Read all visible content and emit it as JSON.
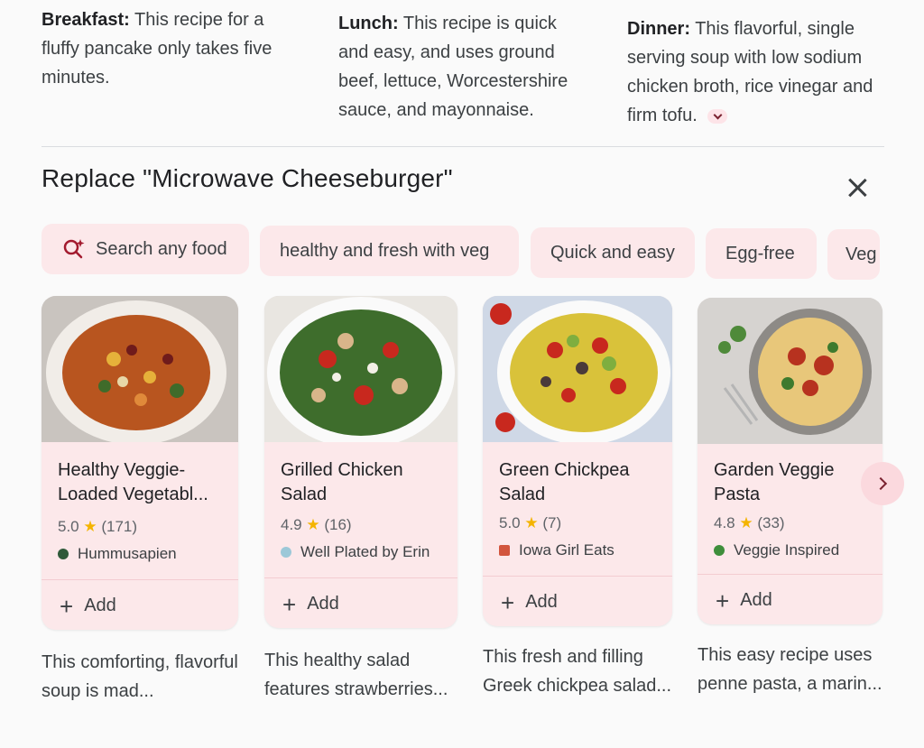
{
  "summary": {
    "breakfast": {
      "label": "Breakfast:",
      "text": "This recipe for a fluffy pancake only takes five minutes."
    },
    "lunch": {
      "label": "Lunch:",
      "text": "This recipe is quick and easy, and uses ground beef, lettuce, Worcestershire sauce, and mayonnaise."
    },
    "dinner": {
      "label": "Dinner:",
      "text": "This flavorful, single serving soup with low sodium chicken broth, rice vinegar and firm tofu."
    }
  },
  "heading": "Replace \"Microwave Cheeseburger\"",
  "chips": {
    "search": "Search any food",
    "items": [
      "healthy and fresh with veg",
      "Quick and easy",
      "Egg-free",
      "Veg"
    ]
  },
  "add_label": "Add",
  "recipes": [
    {
      "title": "Healthy Veggie-Loaded Vegetabl...",
      "rating": "5.0",
      "count": "(171)",
      "source": "Hummusapien",
      "desc": "This comforting, flavorful soup is mad...",
      "source_color": "#2f5a3a"
    },
    {
      "title": "Grilled Chicken Salad",
      "rating": "4.9",
      "count": "(16)",
      "source": "Well Plated by Erin",
      "desc": "This healthy salad features strawberries...",
      "source_color": "#9cc8d8"
    },
    {
      "title": "Green Chickpea Salad",
      "rating": "5.0",
      "count": "(7)",
      "source": "Iowa Girl Eats",
      "desc": "This fresh and filling Greek chickpea salad...",
      "source_color": "#d2553d"
    },
    {
      "title": "Garden Veggie Pasta",
      "rating": "4.8",
      "count": "(33)",
      "source": "Veggie Inspired",
      "desc": "This easy recipe uses penne pasta, a marin...",
      "source_color": "#3e8e3b"
    }
  ],
  "colors": {
    "chip_bg": "#fce8ea",
    "card_bg": "#fce8ea",
    "accent": "#7a2230",
    "star": "#f4b400"
  }
}
